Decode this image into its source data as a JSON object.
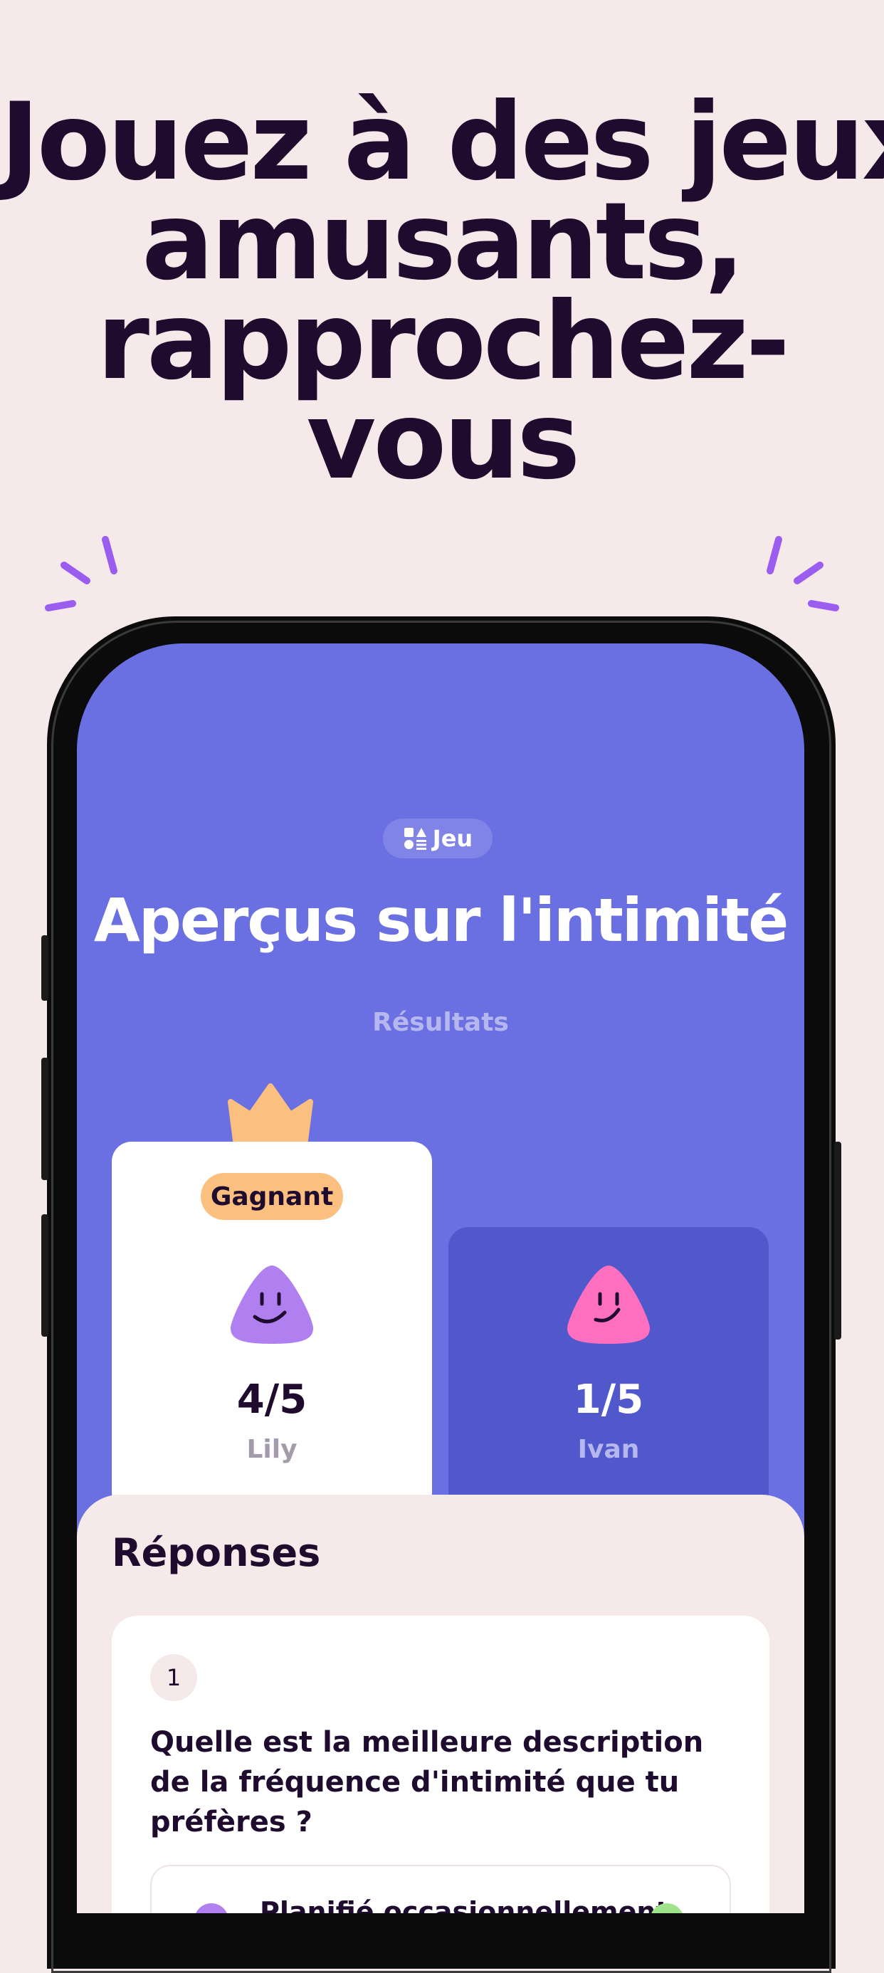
{
  "headline": {
    "lines": [
      "Jouez à des jeux",
      "amusants,",
      "rapprochez-",
      "vous"
    ]
  },
  "screen": {
    "chip_label": "Jeu",
    "game_title": "Aperçus sur l'intimité",
    "results_label": "Résultats",
    "winner": {
      "badge": "Gagnant",
      "score": "4/5",
      "name": "Lily",
      "avatar_color": "#b07ff0"
    },
    "other": {
      "score": "1/5",
      "name": "Ivan",
      "avatar_color": "#ff6fbf"
    },
    "answers_title": "Réponses",
    "question": {
      "number": "1",
      "text": "Quelle est la meilleure description de la fréquence d'intimité que tu préfères ?",
      "option_text": "Planifié occasionnellement"
    }
  },
  "colors": {
    "background": "#f5e9ea",
    "ink": "#1e0b2e",
    "screen_blue": "#6a70e2",
    "loser_card": "#5058cc",
    "crown": "#fbbf7f",
    "spark": "#9b5cf0"
  },
  "icons": [
    "spark-left-icon",
    "spark-right-icon",
    "game-icon",
    "crown-icon",
    "avatar-lily-icon",
    "avatar-ivan-icon"
  ]
}
